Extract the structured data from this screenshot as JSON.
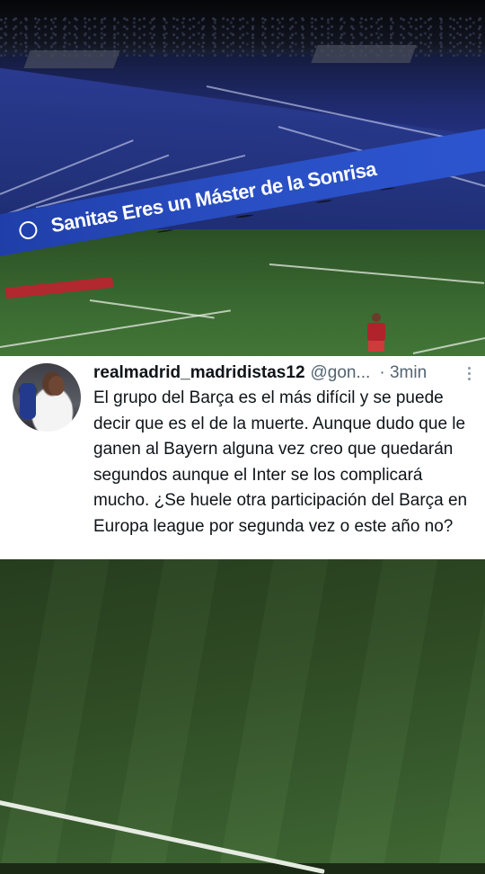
{
  "tweet": {
    "display_name": "realmadrid_madridistas12",
    "handle": "@gon...",
    "time": "· 3min",
    "more_icon": "vertical-ellipsis-icon",
    "text": "El grupo del Barça es el más difícil y se puede decir que es el de la muerte. Aunque dudo que le ganen al Bayern alguna vez creo que quedarán segundos aunque el Inter se los complicará mucho. ¿Se huele otra participación del Barça en Europa league por segunda vez o este año no?"
  },
  "background": {
    "ad_board_text": "Sanitas  Eres un Máster de la Sonrisa",
    "colors": {
      "stand_blue": "#26348a",
      "pitch_green": "#3a6a31",
      "ad_board_blue": "#2a4fc4"
    }
  }
}
